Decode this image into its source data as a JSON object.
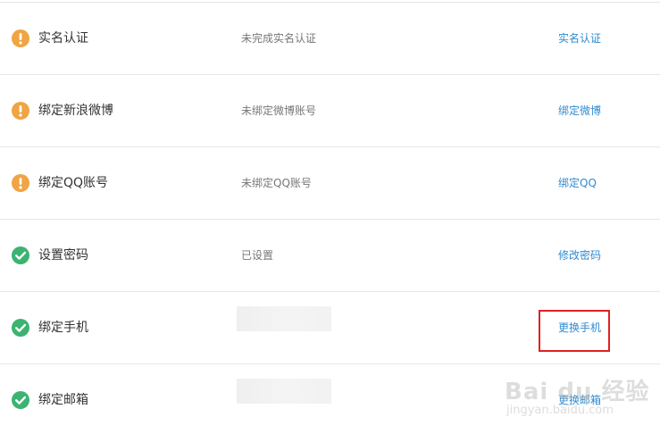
{
  "colors": {
    "warning": "#f0a442",
    "success": "#3cb371",
    "link": "#2f8bd0",
    "highlight": "#e02020"
  },
  "rows": [
    {
      "icon": "warning-icon",
      "name": "实名认证",
      "status": "未完成实名认证",
      "action": "实名认证"
    },
    {
      "icon": "warning-icon",
      "name": "绑定新浪微博",
      "status": "未绑定微博账号",
      "action": "绑定微博"
    },
    {
      "icon": "warning-icon",
      "name": "绑定QQ账号",
      "status": "未绑定QQ账号",
      "action": "绑定QQ"
    },
    {
      "icon": "check-icon",
      "name": "设置密码",
      "status": "已设置",
      "action": "修改密码"
    },
    {
      "icon": "check-icon",
      "name": "绑定手机",
      "status": "",
      "action": "更换手机"
    },
    {
      "icon": "check-icon",
      "name": "绑定邮箱",
      "status": "",
      "action": "更换邮箱"
    }
  ],
  "watermark": {
    "logo": "Bai du 经验",
    "sub": "jingyan.baidu.com"
  }
}
